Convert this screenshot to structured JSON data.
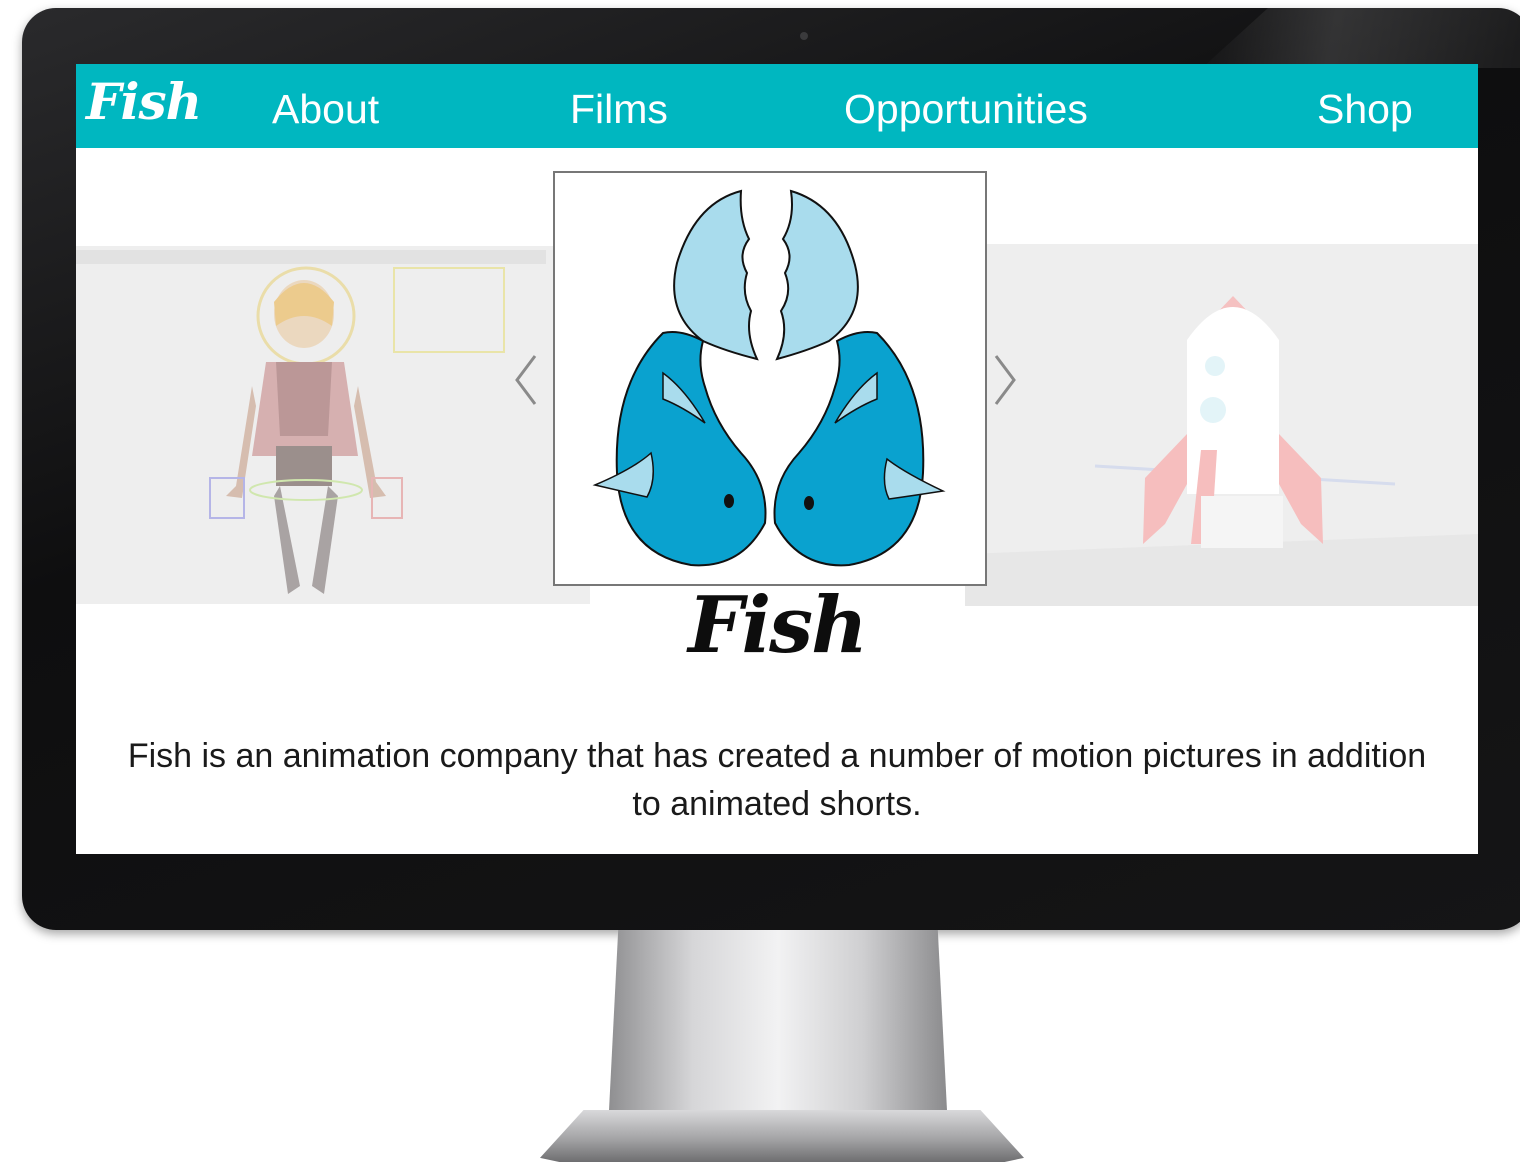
{
  "nav": {
    "logo": "Fish",
    "links": [
      "About",
      "Films",
      "Opportunities",
      "Shop"
    ]
  },
  "hero": {
    "title": "Fish",
    "description": "Fish is an animation company that has created a number of motion pictures in addition to animated shorts."
  },
  "carousel": {
    "prev_icon": "chevron-left-icon",
    "next_icon": "chevron-right-icon",
    "slides": [
      "character-rig-thumbnail",
      "fish-logo",
      "rocket-thumbnail"
    ]
  },
  "colors": {
    "navbar": "#00b7c0",
    "nav_text": "#ffffff",
    "fish_dark": "#0aa2cf",
    "fish_light": "#a9dced",
    "title_text": "#0d0d0d"
  }
}
